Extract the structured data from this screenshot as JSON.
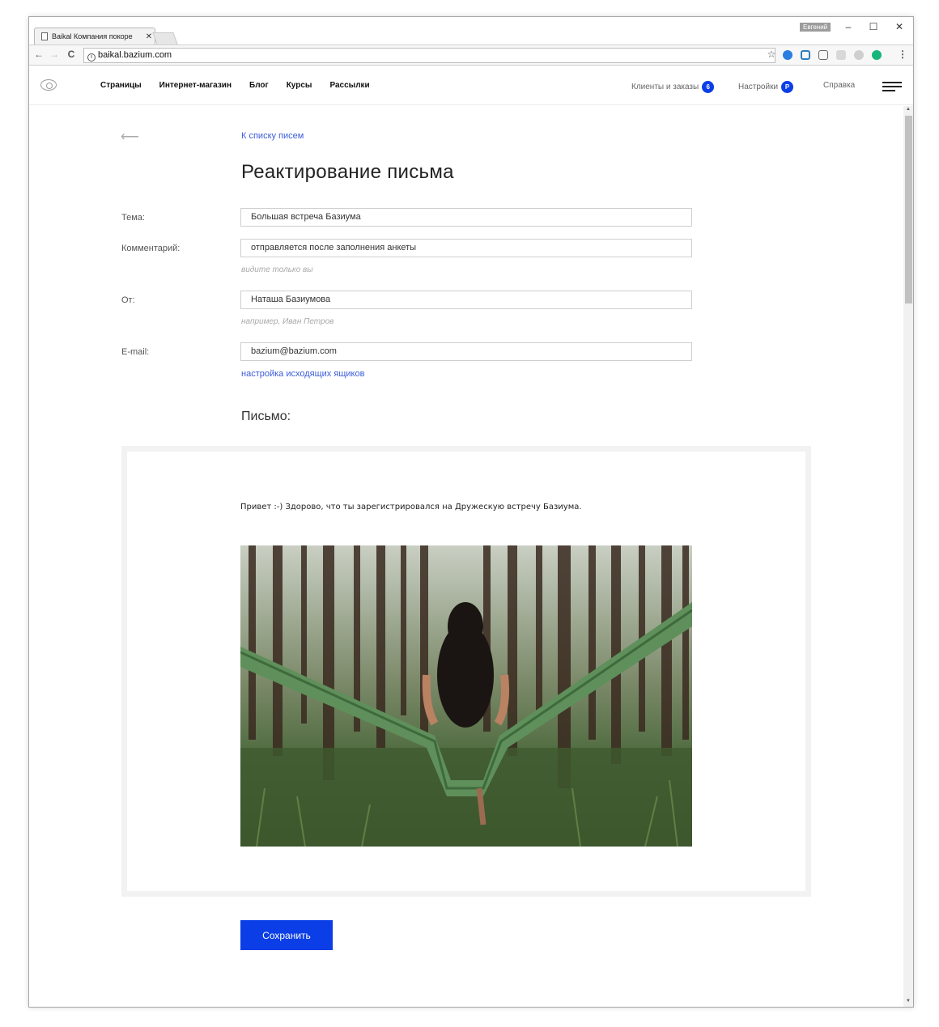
{
  "browser": {
    "tab_title": "Baikal Компания покоре",
    "tab_close": "✕",
    "user_name": "Евгений",
    "url": "baikal.bazium.com",
    "window_controls": {
      "minimize": "–",
      "maximize": "☐",
      "close": "✕"
    }
  },
  "app": {
    "nav": [
      "Страницы",
      "Интернет-магазин",
      "Блог",
      "Курсы",
      "Рассылки"
    ],
    "clients_label": "Клиенты и заказы",
    "clients_count": "6",
    "settings_label": "Настройки",
    "settings_badge": "P",
    "help_label": "Справка"
  },
  "page": {
    "back_link": "К списку писем",
    "title": "Реактирование письма",
    "subject_label": "Тема:",
    "subject_value": "Большая встреча Базиума",
    "comment_label": "Комментарий:",
    "comment_value": "отправляется после заполнения анкеты",
    "comment_hint": "видите только вы",
    "from_label": "От:",
    "from_value": "Наташа Базиумова",
    "from_hint": "например, Иван Петров",
    "email_label": "E-mail:",
    "email_value": "bazium@bazium.com",
    "mailbox_link": "настройка исходящих ящиков",
    "letter_label": "Письмо:",
    "letter_text": "Привет :-) Здорово, что ты зарегистрировался на Дружескую встречу Базиума.",
    "save_label": "Сохранить"
  },
  "colors": {
    "accent": "#0b3ee6",
    "link": "#3a5bd9"
  }
}
